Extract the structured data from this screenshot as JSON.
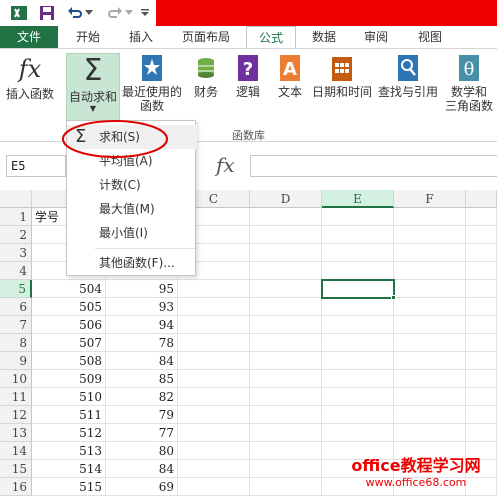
{
  "tabs": [
    "文件",
    "开始",
    "插入",
    "页面布局",
    "公式",
    "数据",
    "审阅",
    "视图"
  ],
  "active_tab": "公式",
  "ribbon": {
    "buttons": [
      {
        "label": "插入函数"
      },
      {
        "label": "自动求和"
      },
      {
        "label": "最近使用的\n函数"
      },
      {
        "label": "财务"
      },
      {
        "label": "逻辑"
      },
      {
        "label": "文本"
      },
      {
        "label": "日期和时间"
      },
      {
        "label": "查找与引用"
      },
      {
        "label": "数学和\n三角函数"
      }
    ],
    "group_label": "函数库"
  },
  "formula_bar": {
    "name_box": "E5",
    "fx": "fx",
    "value": ""
  },
  "columns": [
    "C",
    "D",
    "E",
    "F"
  ],
  "rows": [
    {
      "n": "1",
      "a": "学号",
      "b": ""
    },
    {
      "n": "2",
      "a": "",
      "b": ""
    },
    {
      "n": "3",
      "a": "",
      "b": ""
    },
    {
      "n": "4",
      "a": "",
      "b": ""
    },
    {
      "n": "5",
      "a": "504",
      "b": "95"
    },
    {
      "n": "6",
      "a": "505",
      "b": "93"
    },
    {
      "n": "7",
      "a": "506",
      "b": "94"
    },
    {
      "n": "8",
      "a": "507",
      "b": "78"
    },
    {
      "n": "9",
      "a": "508",
      "b": "84"
    },
    {
      "n": "10",
      "a": "509",
      "b": "85"
    },
    {
      "n": "11",
      "a": "510",
      "b": "82"
    },
    {
      "n": "12",
      "a": "511",
      "b": "79"
    },
    {
      "n": "13",
      "a": "512",
      "b": "77"
    },
    {
      "n": "14",
      "a": "513",
      "b": "80"
    },
    {
      "n": "15",
      "a": "514",
      "b": "84"
    },
    {
      "n": "16",
      "a": "515",
      "b": "69"
    }
  ],
  "dropdown": {
    "items": [
      "求和(S)",
      "平均值(A)",
      "计数(C)",
      "最大值(M)",
      "最小值(I)",
      "其他函数(F)..."
    ]
  },
  "watermark": {
    "title": "office教程学习网",
    "url": "www.office68.com"
  },
  "colors": {
    "accent": "#217346",
    "red": "#e00000"
  }
}
